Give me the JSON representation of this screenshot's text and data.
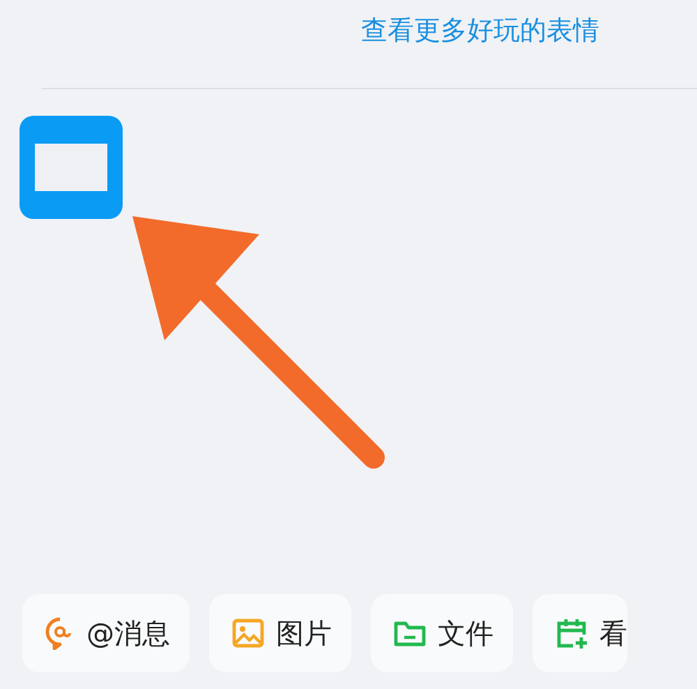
{
  "emoji_link": "查看更多好玩的表情",
  "toolbar": [
    {
      "kind": "mention",
      "label": "@消息"
    },
    {
      "kind": "image",
      "label": "图片"
    },
    {
      "kind": "file",
      "label": "文件"
    },
    {
      "kind": "calendar",
      "label": "看"
    }
  ]
}
